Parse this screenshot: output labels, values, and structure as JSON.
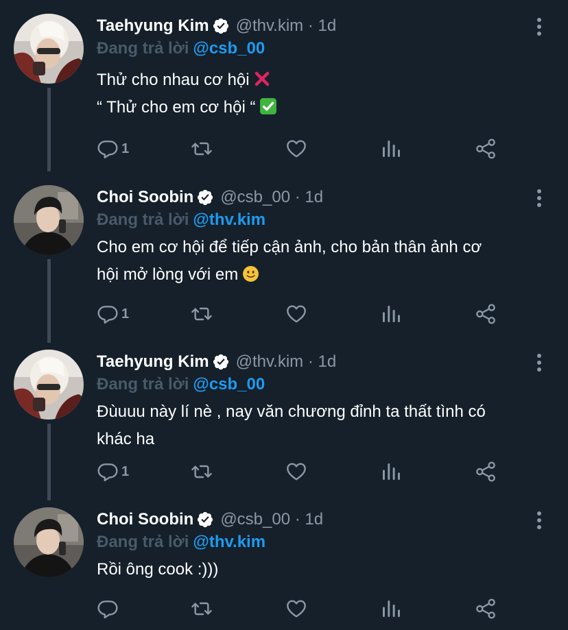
{
  "tweets": [
    {
      "name": "Taehyung Kim",
      "handle": "@thv.kim · 1d",
      "reply_prefix": "Đang trả lời",
      "reply_to": "@csb_00",
      "lines": [
        "Thử cho nhau cơ hội",
        "“ Thử cho em cơ hội “"
      ],
      "reply_count": "1",
      "avatar_icon": "avatar-blonde-sunglasses"
    },
    {
      "name": "Choi Soobin",
      "handle": "@csb_00 · 1d",
      "reply_prefix": "Đang trả lời",
      "reply_to": "@thv.kim",
      "lines": [
        "Cho em cơ hội để tiếp cận ảnh, cho bản thân ảnh cơ",
        "hội mở lòng với em"
      ],
      "reply_count": "1",
      "avatar_icon": "avatar-dark-hair"
    },
    {
      "name": "Taehyung Kim",
      "handle": "@thv.kim · 1d",
      "reply_prefix": "Đang trả lời",
      "reply_to": "@csb_00",
      "lines": [
        "Đùuuu này lí nè , nay văn chương đỉnh ta thất tình có",
        "khác ha"
      ],
      "reply_count": "1",
      "avatar_icon": "avatar-blonde-sunglasses"
    },
    {
      "name": "Choi Soobin",
      "handle": "@csb_00 · 1d",
      "reply_prefix": "Đang trả lời",
      "reply_to": "@thv.kim",
      "lines": [
        "Rồi ông cook :)))"
      ],
      "reply_count": "",
      "avatar_icon": "avatar-dark-hair"
    }
  ],
  "colors": {
    "background": "#15202b",
    "mention": "#1d9bf0",
    "secondary_text": "#8b98a5",
    "reply_prefix": "#4a5a69",
    "verified": "#ffffff",
    "thread_line": "#3d4a56"
  },
  "icons": {
    "verified": "verified-badge-icon",
    "more": "more-vertical-icon",
    "reply": "reply-bubble-icon",
    "retweet": "retweet-icon",
    "like": "heart-icon",
    "analytics": "analytics-bars-icon",
    "share": "share-icon",
    "cross_emoji": "cross-mark-emoji",
    "check_emoji": "check-mark-emoji",
    "smile_emoji": "slightly-smiling-face-emoji"
  }
}
